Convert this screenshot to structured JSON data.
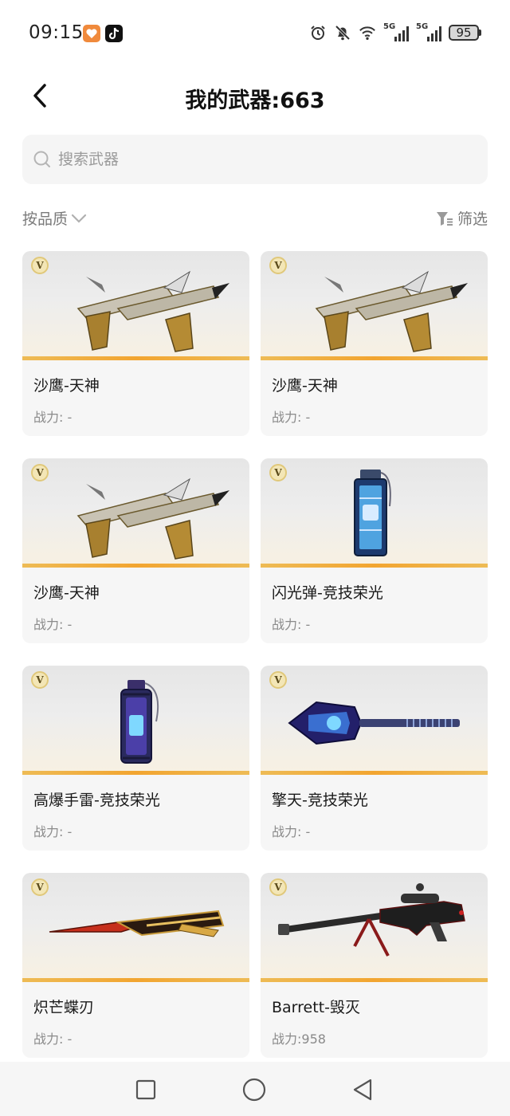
{
  "status_bar": {
    "time": "09:15",
    "network_labels": [
      "5G",
      "5G"
    ],
    "battery": "95"
  },
  "header": {
    "title": "我的武器:663",
    "back_icon": "chevron-left-icon"
  },
  "search": {
    "placeholder": "搜索武器",
    "value": ""
  },
  "filters": {
    "sort_label": "按品质",
    "filter_label": "筛选"
  },
  "weapons": [
    {
      "name": "沙鹰-天神",
      "power": "战力: -",
      "badge": "V",
      "art": "dual-pistols"
    },
    {
      "name": "沙鹰-天神",
      "power": "战力: -",
      "badge": "V",
      "art": "dual-pistols"
    },
    {
      "name": "沙鹰-天神",
      "power": "战力: -",
      "badge": "V",
      "art": "dual-pistols"
    },
    {
      "name": "闪光弹-竞技荣光",
      "power": "战力: -",
      "badge": "V",
      "art": "flashbang"
    },
    {
      "name": "高爆手雷-竞技荣光",
      "power": "战力: -",
      "badge": "V",
      "art": "grenade"
    },
    {
      "name": "擎天-竞技荣光",
      "power": "战力: -",
      "badge": "V",
      "art": "shovel"
    },
    {
      "name": "炽芒蝶刃",
      "power": "战力: -",
      "badge": "V",
      "art": "butterfly-knife"
    },
    {
      "name": "Barrett-毁灭",
      "power": "战力:958",
      "badge": "V",
      "art": "sniper-rifle"
    }
  ],
  "colors": {
    "accent_gold": "#f2a530",
    "card_bg": "#f6f6f6",
    "muted_text": "#8a8a8a"
  }
}
